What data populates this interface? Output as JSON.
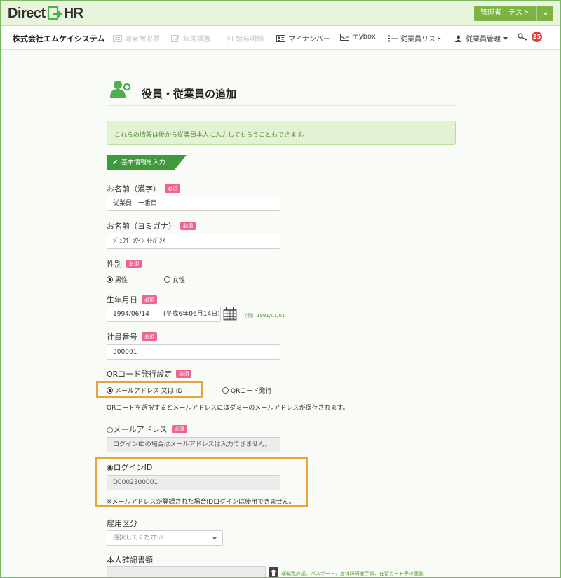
{
  "header": {
    "logo_left": "Direct",
    "logo_right": "HR",
    "user_label": "管理者　テスト"
  },
  "nav": {
    "company": "株式会社エムケイシステム",
    "items": [
      {
        "label": "源泉徴収票",
        "icon": "receipt-icon",
        "enabled": false
      },
      {
        "label": "年末調整",
        "icon": "pencil-icon",
        "enabled": false
      },
      {
        "label": "給与明細",
        "icon": "money-icon",
        "enabled": false
      },
      {
        "label": "マイナンバー",
        "icon": "id-card-icon",
        "enabled": true
      },
      {
        "label": "mybox",
        "icon": "inbox-icon",
        "enabled": true
      },
      {
        "label": "従業員リスト",
        "icon": "list-icon",
        "enabled": true
      },
      {
        "label": "従業員管理",
        "icon": "user-icon",
        "enabled": true
      }
    ],
    "notification_count": "25"
  },
  "page": {
    "title": "役員・従業員の追加",
    "alert": "これらの情報は後から従業員本人に入力してもらうこともできます。",
    "section_title": "基本情報を入力"
  },
  "form": {
    "required_label": "必須",
    "name_kanji": {
      "label": "お名前（漢字）",
      "value": "従業員　一番目"
    },
    "name_kana": {
      "label": "お名前（ヨミガナ）",
      "value": "ｼﾞｭｳｷﾞｮｳｲﾝ ｲﾁﾊﾞﾝﾒ"
    },
    "gender": {
      "label": "性別",
      "options": [
        "男性",
        "女性"
      ],
      "selected": "男性"
    },
    "birthdate": {
      "label": "生年月日",
      "value": "1994/06/14",
      "era": "(平成6年06月14日)",
      "example": "（例）1991/01/01"
    },
    "employee_number": {
      "label": "社員番号",
      "value": "300001"
    },
    "qr": {
      "label": "QRコード発行設定",
      "option_email": "メールアドレス 又は ID",
      "option_qr": "QRコード発行",
      "selected": "メールアドレス 又は ID",
      "note": "QRコードを選択するとメールアドレスにはダミーのメールアドレスが保存されます。"
    },
    "email": {
      "label": "○メールアドレス",
      "value": "ログインIDの場合はメールアドレスは入力できません。"
    },
    "login_id": {
      "label": "◉ログインID",
      "value": "D0002300001",
      "note": "※メールアドレスが登録された場合IDログインは使用できません。"
    },
    "employment_type": {
      "label": "雇用区分",
      "placeholder": "選択してください"
    },
    "identity_doc": {
      "label": "本人確認書類",
      "note": "運転免許証、パスポート、身体障碍者手帳、在留カード等の画像"
    }
  },
  "colors": {
    "brand_green": "#7cb342",
    "section_green": "#3e9a3a",
    "required_pink": "#f06292",
    "highlight_orange": "#e8a33a",
    "badge_red": "#e53935"
  }
}
